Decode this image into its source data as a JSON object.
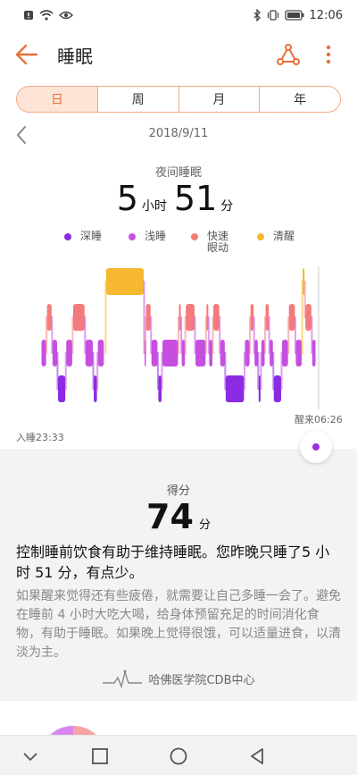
{
  "status_bar": {
    "time": "12:06"
  },
  "header": {
    "title": "睡眠"
  },
  "tabs": [
    {
      "label": "日",
      "active": true
    },
    {
      "label": "周",
      "active": false
    },
    {
      "label": "月",
      "active": false
    },
    {
      "label": "年",
      "active": false
    }
  ],
  "date": "2018/9/11",
  "sleep_summary": {
    "label": "夜间睡眠",
    "hours": "5",
    "hours_unit": "小时",
    "minutes": "51",
    "minutes_unit": "分"
  },
  "legend": [
    {
      "label": "深睡",
      "color": "#8b2be2"
    },
    {
      "label": "浅睡",
      "color": "#c64fe0"
    },
    {
      "label": "快速\n眼动",
      "color": "#f47b7b"
    },
    {
      "label": "清醒",
      "color": "#f5b82e"
    }
  ],
  "chart": {
    "wake_label": "醒来06:26",
    "sleep_label": "入睡23:33",
    "stage_order": [
      "awake",
      "rem",
      "light",
      "deep"
    ]
  },
  "score": {
    "label": "得分",
    "value": "74",
    "unit": "分",
    "summary": "控制睡前饮食有助于维持睡眠。您昨晚只睡了5 小时 51 分，有点少。",
    "advice": "如果醒来觉得还有些疲倦，就需要让自己多睡一会了。避免在睡前 4 小时大吃大喝，给身体预留充足的时间消化食物，有助于睡眠。如果晚上觉得很饿，可以适量进食，以清淡为主。",
    "source": "哈佛医学院CDB中心"
  },
  "colors": {
    "accent": "#e8703a",
    "deep": "#8b2be2",
    "light": "#c64fe0",
    "rem": "#f47b7b",
    "awake": "#f5b82e"
  }
}
